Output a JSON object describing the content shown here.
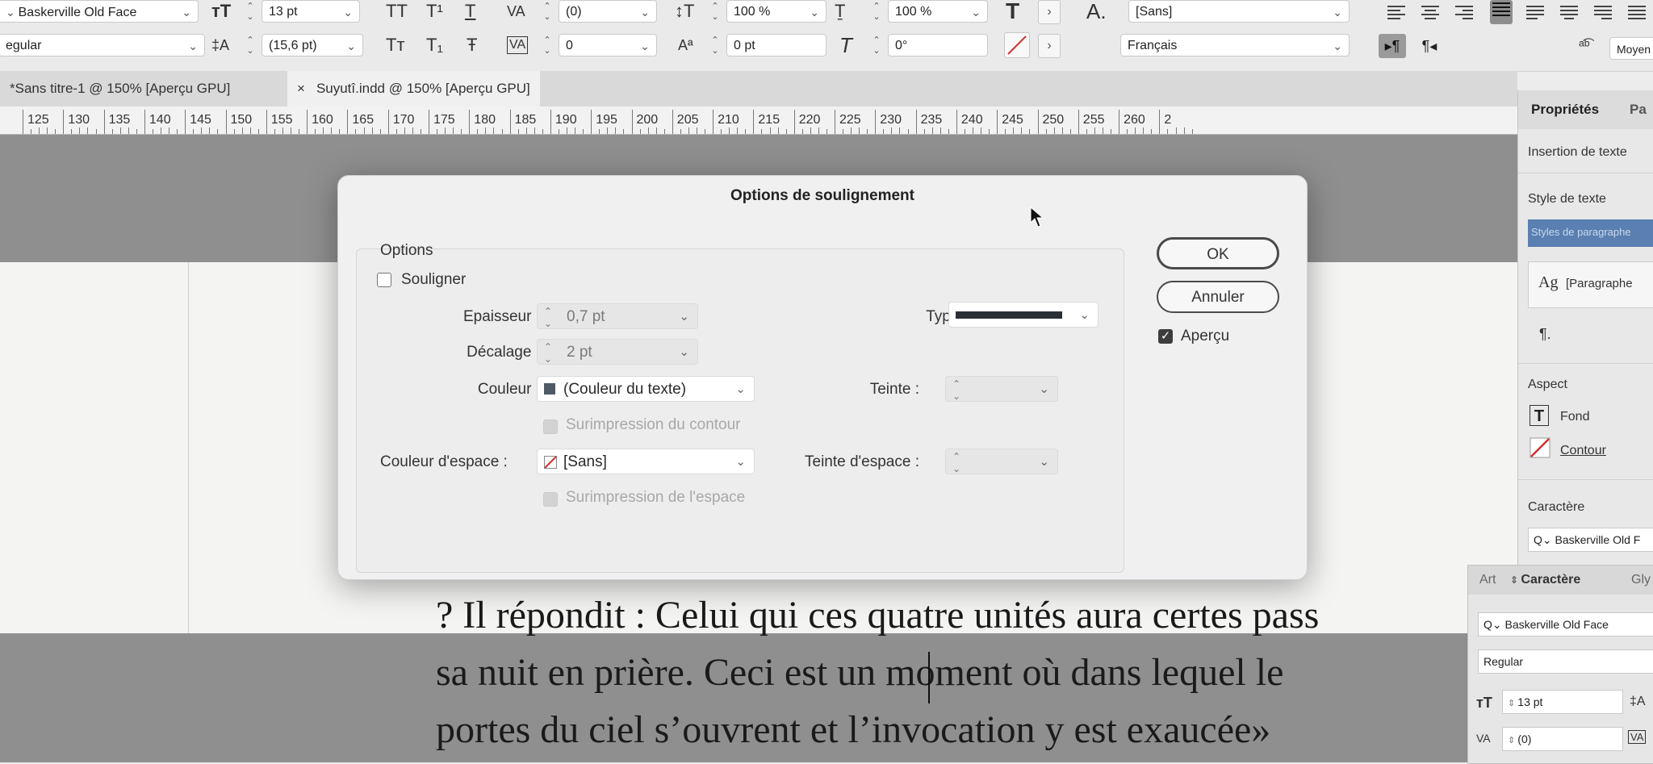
{
  "control_bar": {
    "row1": {
      "font_family": "Baskerville Old Face",
      "font_size": "13 pt",
      "tracking": "(0)",
      "vertical_scale": "100 %",
      "horizontal_scale": "100 %",
      "char_style": "[Sans]"
    },
    "row2": {
      "font_style": "egular",
      "leading": "(15,6 pt)",
      "kerning": "0",
      "baseline_shift": "0 pt",
      "skew": "0°",
      "language": "Français",
      "right_field": "Moyen"
    }
  },
  "tabs": [
    {
      "label": "*Sans titre-1 @ 150% [Aperçu GPU]"
    },
    {
      "label": "Suyutî.indd @ 150% [Aperçu GPU]",
      "close": "×"
    }
  ],
  "ruler": {
    "labels": [
      "125",
      "130",
      "135",
      "140",
      "145",
      "150",
      "155",
      "160",
      "165",
      "170",
      "175",
      "180",
      "185",
      "190",
      "195",
      "200",
      "205",
      "210",
      "215",
      "220",
      "225",
      "230",
      "235",
      "240",
      "245",
      "250",
      "255",
      "260",
      "2"
    ]
  },
  "document": {
    "lines": [
      "? Il répondit : Celui qui ces quatre unités aura certes pass",
      "sa nuit en prière. Ceci est un moment où dans lequel le",
      "portes du ciel s’ouvrent et l’invocation y est exaucée»"
    ]
  },
  "dialog": {
    "title": "Options de soulignement",
    "group_label": "Options",
    "underline_label": "Souligner",
    "underline_checked": false,
    "thickness_label": "Epaisseur :",
    "thickness_value": "0,7 pt",
    "offset_label": "Décalage :",
    "offset_value": "2 pt",
    "type_label": "Type :",
    "color_label": "Couleur :",
    "color_value": "(Couleur du texte)",
    "tint_label": "Teinte :",
    "overprint_stroke_label": "Surimpression du contour",
    "gap_color_label": "Couleur d'espace :",
    "gap_color_value": "[Sans]",
    "gap_tint_label": "Teinte d'espace :",
    "overprint_gap_label": "Surimpression de l'espace",
    "ok_label": "OK",
    "cancel_label": "Annuler",
    "preview_label": "Aperçu",
    "preview_checked": true
  },
  "properties_panel": {
    "tab_active": "Propriétés",
    "tab_other": "Pa",
    "insertion_label": "Insertion de texte",
    "text_style_label": "Style de texte",
    "para_styles_label": "Styles de paragraphe",
    "para_style_value": "[Paragraphe",
    "aspect_label": "Aspect",
    "fill_label": "Fond",
    "stroke_label": "Contour",
    "character_label": "Caractère",
    "font_search_value": "Baskerville Old F"
  },
  "character_panel": {
    "tab_left": "Art",
    "tab_active": "Caractère",
    "tab_right": "Gly",
    "font_family": "Baskerville Old Face",
    "font_style": "Regular",
    "font_size": "13 pt",
    "tracking": "(0)"
  },
  "colors": {
    "accent": "#5a7fb0",
    "none_swatch": "#d0312d",
    "canvas_gray": "#8f8f8f",
    "dialog_bg": "#f0f0f0"
  }
}
